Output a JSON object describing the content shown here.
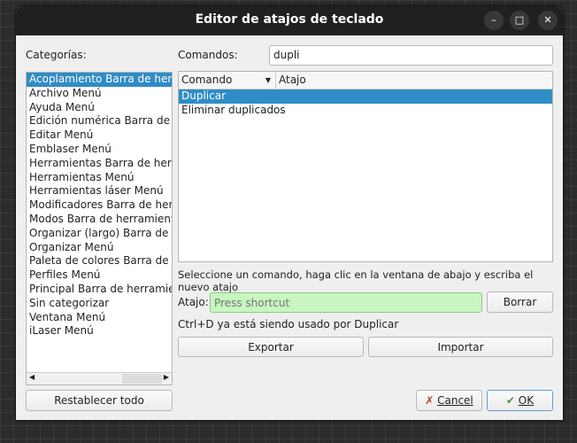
{
  "window": {
    "title": "Editor de atajos de teclado"
  },
  "categories": {
    "label": "Categorías:",
    "items": [
      "Acoplamiento Barra de herramientas",
      "Archivo Menú",
      "Ayuda Menú",
      "Edición numérica Barra de herramientas",
      "Editar Menú",
      "Emblaser Menú",
      "Herramientas Barra de herramientas",
      "Herramientas Menú",
      "Herramientas láser Menú",
      "Modificadores Barra de herramientas",
      "Modos Barra de herramientas",
      "Organizar (largo) Barra de herramientas",
      "Organizar Menú",
      "Paleta de colores Barra de herramientas",
      "Perfiles Menú",
      "Principal Barra de herramientas",
      "Sin categorizar",
      "Ventana Menú",
      "iLaser Menú"
    ],
    "reset_label": "Restablecer todo"
  },
  "commands": {
    "label": "Comandos:",
    "filter_value": "dupli",
    "columns": [
      "Comando",
      "Atajo"
    ],
    "rows": [
      {
        "command": "Duplicar",
        "shortcut": ""
      },
      {
        "command": "Eliminar duplicados",
        "shortcut": ""
      }
    ]
  },
  "hint": "Seleccione un comando, haga clic en la ventana de abajo y escriba el nuevo atajo",
  "shortcut": {
    "label": "Atajo:",
    "placeholder": "Press shortcut",
    "clear_label": "Borrar",
    "status": "Ctrl+D ya está siendo usado por Duplicar"
  },
  "buttons": {
    "export": "Exportar",
    "import": "Importar",
    "cancel": "Cancel",
    "ok": "OK"
  },
  "colors": {
    "selection": "#308cc6",
    "shortcut_field": "#c8f5c0"
  }
}
